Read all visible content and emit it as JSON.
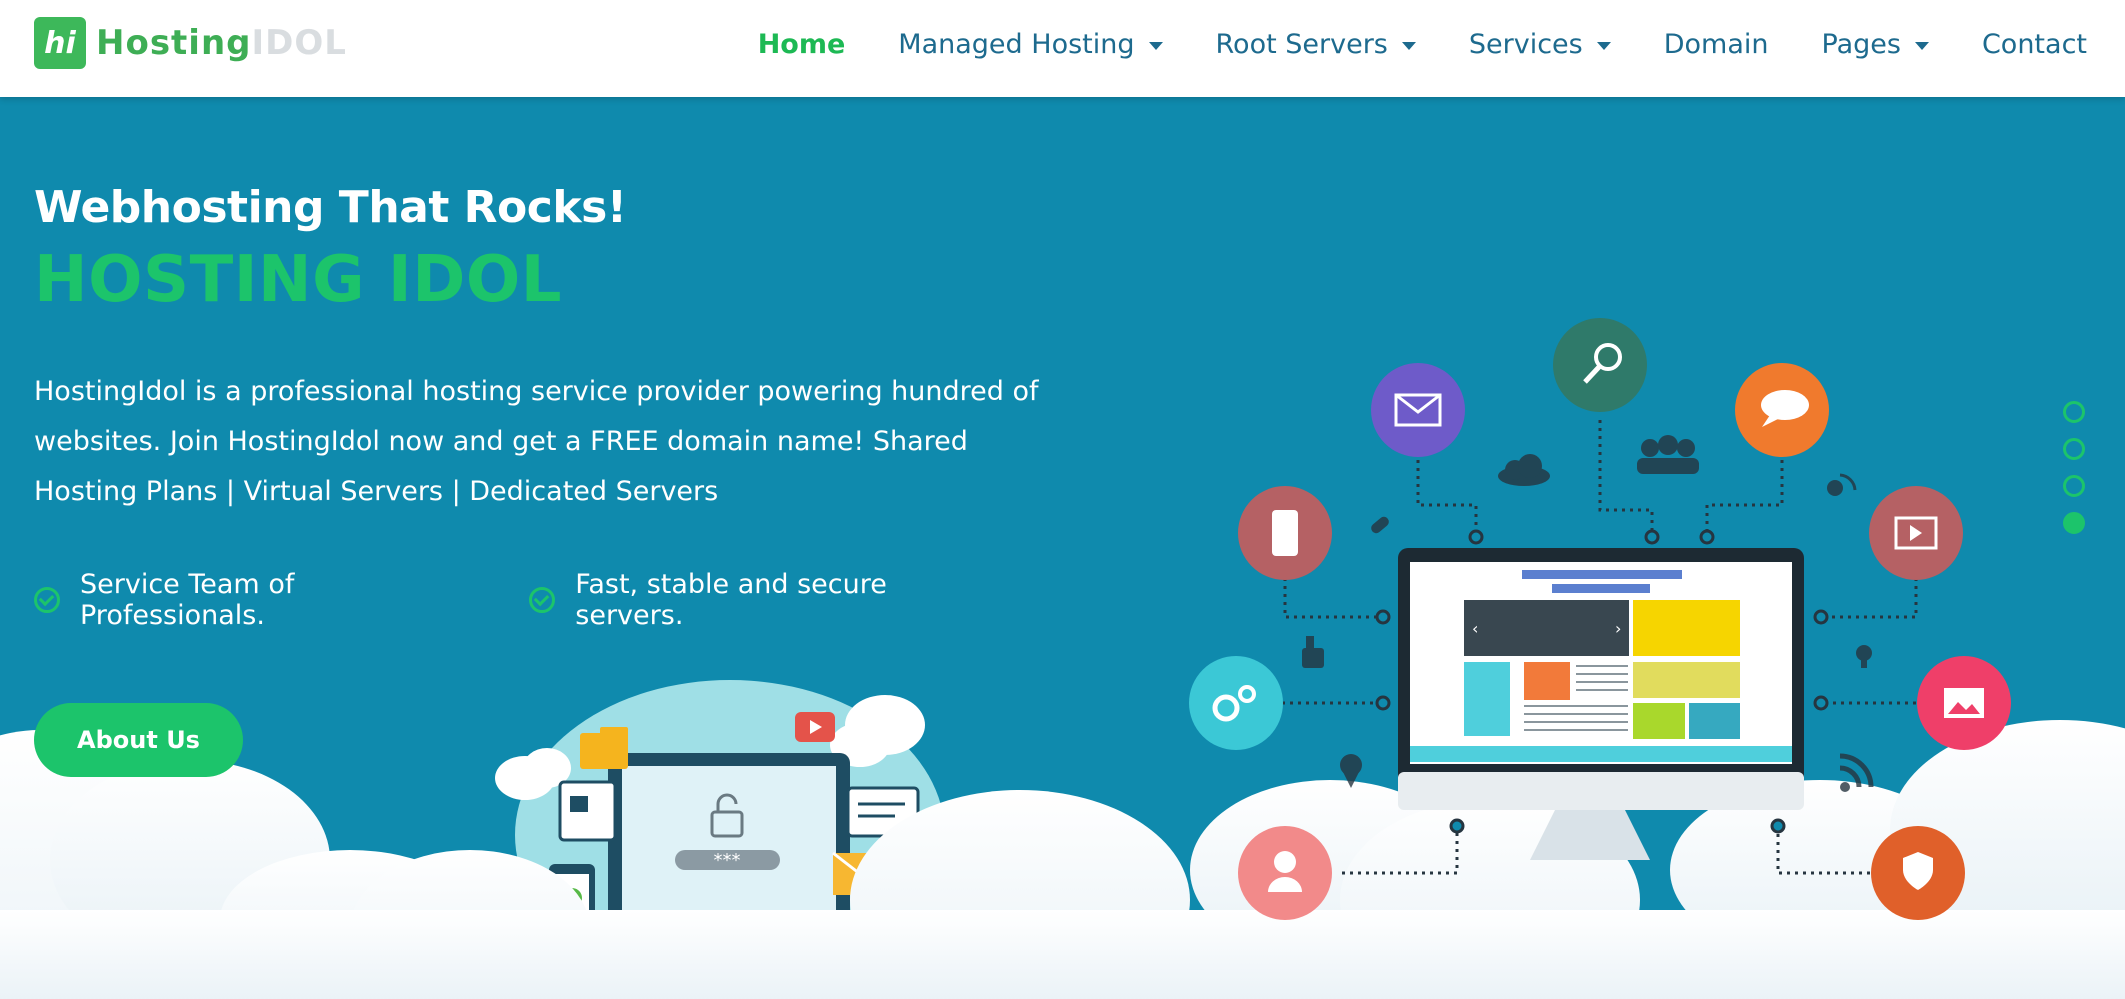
{
  "header": {
    "logo_mark": "hi",
    "logo_text_a": "Hosting",
    "logo_text_b": "IDOL",
    "nav": [
      {
        "label": "Home",
        "active": true,
        "dropdown": false
      },
      {
        "label": "Managed Hosting",
        "active": false,
        "dropdown": true
      },
      {
        "label": "Root Servers",
        "active": false,
        "dropdown": true
      },
      {
        "label": "Services",
        "active": false,
        "dropdown": true
      },
      {
        "label": "Domain",
        "active": false,
        "dropdown": false
      },
      {
        "label": "Pages",
        "active": false,
        "dropdown": true
      },
      {
        "label": "Contact",
        "active": false,
        "dropdown": false
      }
    ]
  },
  "hero": {
    "subtitle": "Webhosting That Rocks!",
    "title": "HOSTING IDOL",
    "desc_line1": "HostingIdol is a professional hosting service provider powering hundred of",
    "desc_line2": "websites. Join HostingIdol now and get a FREE domain name! Shared",
    "desc_line3": "Hosting Plans | Virtual Servers | Dedicated Servers",
    "feature1": "Service Team of Professionals.",
    "feature2": "Fast, stable and secure servers.",
    "button": "About Us",
    "password_mask": "***"
  },
  "slider": {
    "count": 4,
    "active_index": 3
  },
  "colors": {
    "hero_bg": "#0f8aad",
    "accent_green": "#1cc46b",
    "nav_text": "#1d6a8e",
    "cloud": "#ffffff"
  },
  "icons": [
    "mail-icon",
    "search-icon",
    "chat-icon",
    "phone-icon",
    "film-icon",
    "gears-icon",
    "picture-icon",
    "user-icon",
    "shield-icon",
    "cloud-icon",
    "team-icon",
    "link-icon",
    "thumb-icon",
    "pin-icon",
    "rss-icon",
    "satellite-icon",
    "bulb-icon",
    "lock-icon",
    "youtube-icon",
    "folder-icon"
  ]
}
